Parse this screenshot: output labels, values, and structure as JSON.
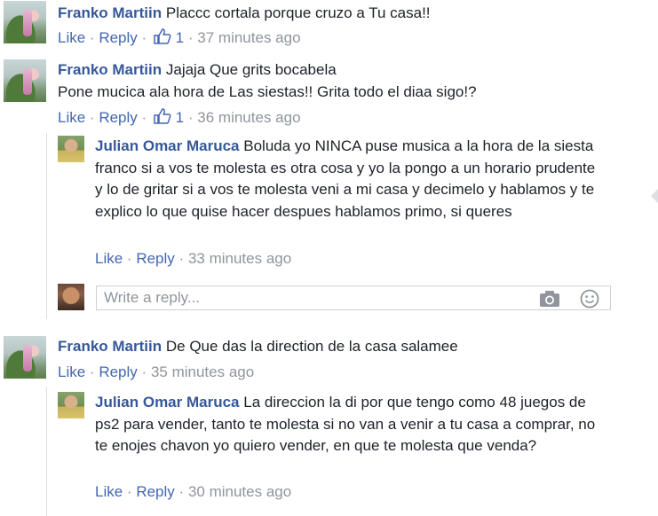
{
  "comments": [
    {
      "author": "Franko Martiin",
      "text": "Placcc cortala porque cruzo a Tu casa!!",
      "like_label": "Like",
      "reply_label": "Reply",
      "likes": "1",
      "time": "37 minutes ago"
    },
    {
      "author": "Franko Martiin",
      "text_line1": "Jajaja Que grits bocabela",
      "text_line2": "Pone mucica ala hora de Las siestas!! Grita todo el diaa sigo!?",
      "like_label": "Like",
      "reply_label": "Reply",
      "likes": "1",
      "time": "36 minutes ago",
      "reply": {
        "author": "Julian Omar Maruca",
        "text": "Boluda yo NINCA puse musica a la hora de la siesta franco si a vos te molesta es otra cosa y yo la pongo a un horario prudente y lo de gritar si a vos te molesta veni a mi casa y decimelo y hablamos y te explico lo que quise hacer despues hablamos primo, si queres",
        "like_label": "Like",
        "reply_label": "Reply",
        "time": "33 minutes ago"
      }
    },
    {
      "author": "Franko Martiin",
      "text": "De Que das la direction de la casa salamee",
      "like_label": "Like",
      "reply_label": "Reply",
      "time": "35 minutes ago",
      "reply": {
        "author": "Julian Omar Maruca",
        "text": "La direccion la di por que tengo como 48 juegos de ps2 para vender, tanto te molesta si no van a venir a tu casa a comprar, no te enojes chavon yo quiero vender, en que te molesta que venda?",
        "like_label": "Like",
        "reply_label": "Reply",
        "time": "30 minutes ago"
      }
    }
  ],
  "reply_box": {
    "placeholder": "Write a reply..."
  },
  "icons": {
    "thumb": "thumbs-up-icon",
    "camera": "camera-icon",
    "emoji": "smiley-icon"
  },
  "colors": {
    "name": "#365899",
    "link": "#4267b2",
    "meta": "#90949c",
    "text": "#1d2129",
    "border": "#dddfe2"
  }
}
